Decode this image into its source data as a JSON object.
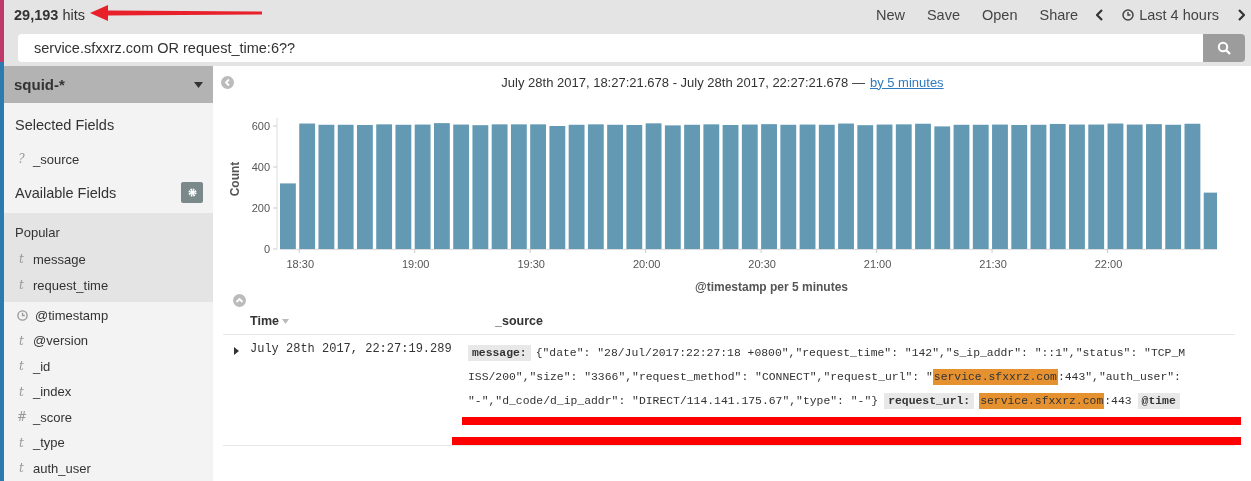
{
  "hits": "**29,193** hits",
  "menu": [
    {
      "label": "New"
    },
    {
      "label": "Save"
    },
    {
      "label": "Open"
    },
    {
      "label": "Share"
    }
  ],
  "time_picker": {
    "label": "Last 4 hours"
  },
  "query": {
    "value": "service.sfxxrz.com OR request_time:6??"
  },
  "sidebar": {
    "index_pattern": "squid-*",
    "selected_title": "Selected Fields",
    "selected_fields": [
      {
        "kind": "text",
        "glyph": "?",
        "name": "_source"
      }
    ],
    "available_title": "Available Fields",
    "popular_title": "Popular",
    "popular_fields": [
      {
        "kind": "text",
        "glyph": "t",
        "name": "message"
      },
      {
        "kind": "text",
        "glyph": "t",
        "name": "request_time"
      }
    ],
    "fields": [
      {
        "kind": "date",
        "name": "@timestamp"
      },
      {
        "kind": "text",
        "glyph": "t",
        "name": "@version"
      },
      {
        "kind": "text",
        "glyph": "t",
        "name": "_id"
      },
      {
        "kind": "text",
        "glyph": "t",
        "name": "_index"
      },
      {
        "kind": "text",
        "glyph": "#",
        "name": "_score"
      },
      {
        "kind": "text",
        "glyph": "t",
        "name": "_type"
      },
      {
        "kind": "text",
        "glyph": "t",
        "name": "auth_user"
      }
    ]
  },
  "range": {
    "text": "July 28th 2017, 18:27:21.678 - July 28th 2017, 22:27:21.678 —",
    "interval_link": "by 5 minutes"
  },
  "chart_data": {
    "type": "bar",
    "xlabel": "@timestamp per 5 minutes",
    "ylabel": "Count",
    "categories": [
      null,
      "18:30",
      null,
      null,
      null,
      null,
      null,
      "19:00",
      null,
      null,
      null,
      null,
      null,
      "19:30",
      null,
      null,
      null,
      null,
      null,
      "20:00",
      null,
      null,
      null,
      null,
      null,
      "20:30",
      null,
      null,
      null,
      null,
      null,
      "21:00",
      null,
      null,
      null,
      null,
      null,
      "21:30",
      null,
      null,
      null,
      null,
      null,
      "22:00",
      null,
      null,
      null,
      null,
      null
    ],
    "values": [
      320,
      612,
      606,
      606,
      605,
      608,
      606,
      607,
      614,
      607,
      604,
      608,
      608,
      608,
      600,
      606,
      608,
      606,
      605,
      613,
      603,
      606,
      608,
      605,
      607,
      609,
      606,
      607,
      606,
      612,
      604,
      607,
      608,
      611,
      598,
      606,
      606,
      607,
      605,
      606,
      610,
      607,
      607,
      612,
      607,
      609,
      606,
      611,
      275
    ],
    "ylim": [
      0,
      640
    ],
    "yticks": [
      0,
      200,
      400,
      600
    ]
  },
  "table": {
    "columns": [
      {
        "label": "Time",
        "sorted": true
      },
      {
        "label": "_source",
        "sorted": false
      }
    ],
    "rows": [
      {
        "expanded": false,
        "time": "July 28th 2017, 22:27:19.289",
        "source": [
          {
            "kind": "key",
            "text": "message:"
          },
          {
            "kind": "text",
            "text": "{\"date\": \"28/Jul/2017:22:27:18 +0800\",\"request_time\": \"142\",\"s_ip_addr\": \"::1\",\"status\": \"TCP_M"
          },
          {
            "kind": "break"
          },
          {
            "kind": "text",
            "text": "ISS/200\",\"size\": \"3366\",\"request_method\": \"CONNECT\",\"request_url\": \""
          },
          {
            "kind": "highlight",
            "text": "service.sfxxrz.com"
          },
          {
            "kind": "text",
            "text": ":443\",\"auth_user\":"
          },
          {
            "kind": "break"
          },
          {
            "kind": "text",
            "text": "\"-\",\"d_code/d_ip_addr\": \"DIRECT/114.141.175.67\",\"type\": \"-\"}"
          },
          {
            "kind": "key",
            "text": "request_url:"
          },
          {
            "kind": "highlight",
            "text": "service.sfxxrz.com"
          },
          {
            "kind": "text",
            "text": ":443"
          },
          {
            "kind": "key",
            "text": "@time"
          }
        ]
      }
    ]
  }
}
